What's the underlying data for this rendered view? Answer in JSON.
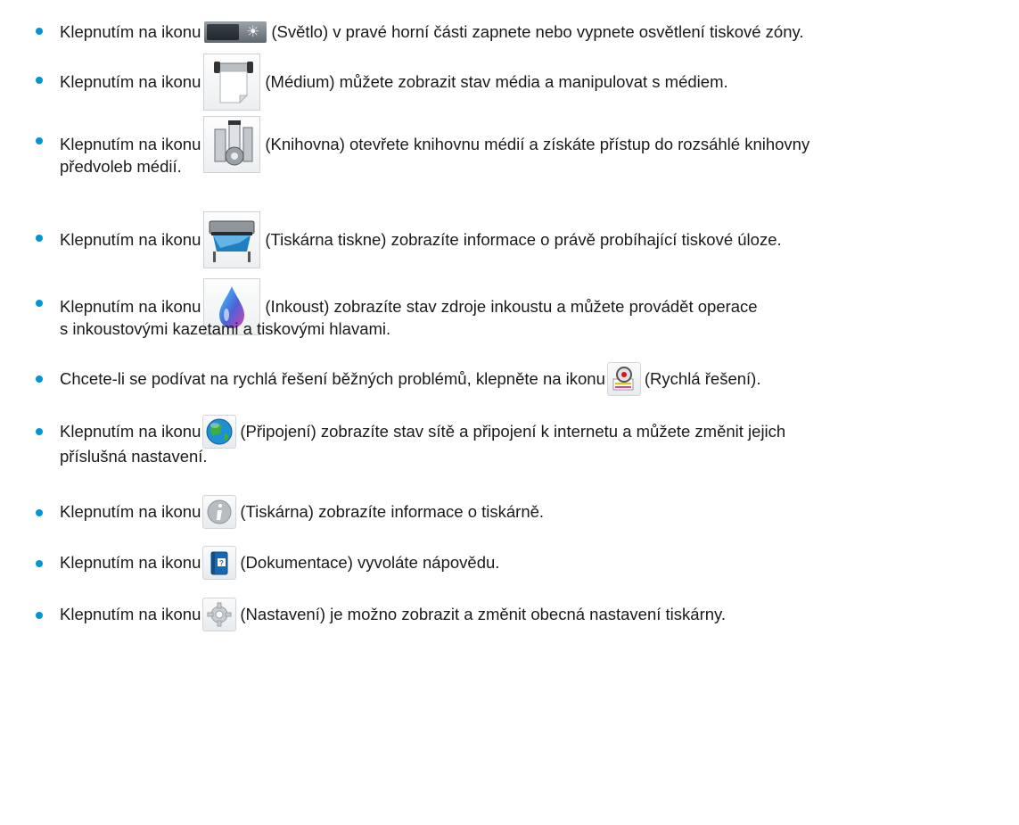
{
  "accent_color": "#0096d6",
  "items": [
    {
      "prefix": "Klepnutím na ikonu",
      "icon": "light-toggle-icon",
      "text": "(Světlo) v pravé horní části zapnete nebo vypnete osvětlení tiskové zóny.",
      "cont": ""
    },
    {
      "prefix": "Klepnutím na ikonu",
      "icon": "media-roll-icon",
      "text": "(Médium) můžete zobrazit stav média a manipulovat s médiem.",
      "cont": ""
    },
    {
      "prefix": "Klepnutím na ikonu",
      "icon": "media-library-icon",
      "text": "(Knihovna) otevřete knihovnu médií a získáte přístup do rozsáhlé knihovny",
      "cont": "předvoleb médií."
    },
    {
      "prefix": "Klepnutím na ikonu",
      "icon": "printer-printing-icon",
      "text": "(Tiskárna tiskne) zobrazíte informace o právě probíhající tiskové úloze.",
      "cont": ""
    },
    {
      "prefix": "Klepnutím na ikonu",
      "icon": "ink-drop-icon",
      "text": "(Inkoust) zobrazíte stav zdroje inkoustu a můžete provádět operace",
      "cont": "s inkoustovými kazetami a tiskovými hlavami."
    },
    {
      "prefix": "Chcete-li se podívat na rychlá řešení běžných problémů, klepněte na ikonu",
      "icon": "quick-solutions-icon",
      "text": "(Rychlá řešení).",
      "cont": ""
    },
    {
      "prefix": "Klepnutím na ikonu",
      "icon": "connectivity-globe-icon",
      "text": "(Připojení) zobrazíte stav sítě a připojení k internetu a můžete změnit jejich",
      "cont": "příslušná nastavení."
    },
    {
      "prefix": "Klepnutím na ikonu",
      "icon": "printer-info-icon",
      "text": "(Tiskárna) zobrazíte informace o tiskárně.",
      "cont": ""
    },
    {
      "prefix": "Klepnutím na ikonu",
      "icon": "documentation-book-icon",
      "text": "(Dokumentace) vyvoláte nápovědu.",
      "cont": ""
    },
    {
      "prefix": "Klepnutím na ikonu",
      "icon": "settings-gear-icon",
      "text": "(Nastavení) je možno zobrazit a změnit obecná nastavení tiskárny.",
      "cont": ""
    }
  ]
}
